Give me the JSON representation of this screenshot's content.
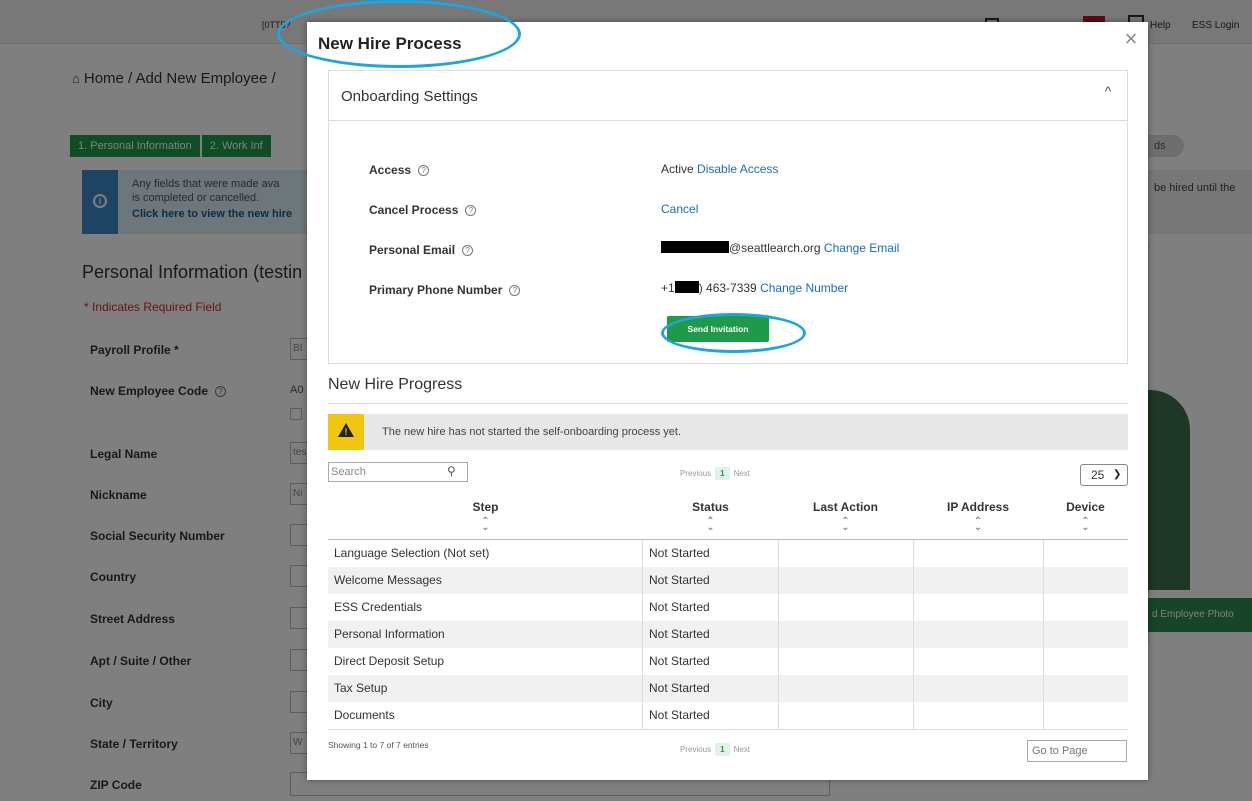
{
  "background": {
    "topbar": {
      "left_text": "[0TT5?",
      "help": "Help",
      "ess_login": "ESS Login"
    },
    "breadcrumb": "Home / Add New Employee /",
    "steps": [
      "1. Personal Information",
      "2. Work Inf"
    ],
    "step_right": "ds",
    "info": {
      "line1": "Any fields that were made ava",
      "line2": "is completed or cancelled.",
      "link": "Click here to view the new hire"
    },
    "info_right": "be hired until the",
    "section_title": "Personal Information (testin",
    "required_note": "* Indicates Required Field",
    "form_labels": [
      "Payroll Profile *",
      "New Employee Code",
      "Legal Name",
      "Nickname",
      "Social Security Number",
      "Country",
      "Street Address",
      "Apt / Suite / Other",
      "City",
      "State / Territory",
      "ZIP Code"
    ],
    "form_values": {
      "payroll_profile": "BI",
      "employee_code": "A0",
      "legal_name": "tes",
      "nickname": "Ni",
      "state": "W"
    },
    "photo_button": "d Employee Photo"
  },
  "modal": {
    "title": "New Hire Process",
    "close_glyph": "×",
    "settings": {
      "title": "Onboarding Settings",
      "collapse_glyph": "^",
      "rows": {
        "access": {
          "label": "Access",
          "status": "Active",
          "action": "Disable Access"
        },
        "cancel": {
          "label": "Cancel Process",
          "action": "Cancel"
        },
        "email": {
          "label": "Personal Email",
          "value": "@seattlearch.org",
          "action": "Change Email"
        },
        "phone": {
          "label": "Primary Phone Number",
          "prefix": "+1",
          "value": ") 463-7339",
          "action": "Change Number"
        }
      },
      "send_button": "Send Invitation"
    },
    "progress": {
      "title": "New Hire Progress",
      "alert": "The new hire has not started the self-onboarding process yet.",
      "search_placeholder": "Search",
      "pager": {
        "previous": "Previous",
        "page": "1",
        "next": "Next"
      },
      "page_size": "25",
      "columns": [
        "Step",
        "Status",
        "Last Action",
        "IP Address",
        "Device"
      ],
      "rows": [
        {
          "step": "Language Selection (Not set)",
          "status": "Not Started"
        },
        {
          "step": "Welcome Messages",
          "status": "Not Started"
        },
        {
          "step": "ESS Credentials",
          "status": "Not Started"
        },
        {
          "step": "Personal Information",
          "status": "Not Started"
        },
        {
          "step": "Direct Deposit Setup",
          "status": "Not Started"
        },
        {
          "step": "Tax Setup",
          "status": "Not Started"
        },
        {
          "step": "Documents",
          "status": "Not Started"
        }
      ],
      "showing": "Showing 1 to 7 of 7 entries",
      "goto_placeholder": "Go to Page"
    }
  },
  "colors": {
    "accent_green": "#1f9a48",
    "link_blue": "#1a6fae",
    "annotation_blue": "#1fa4dd",
    "alert_yellow": "#f1c40f"
  }
}
